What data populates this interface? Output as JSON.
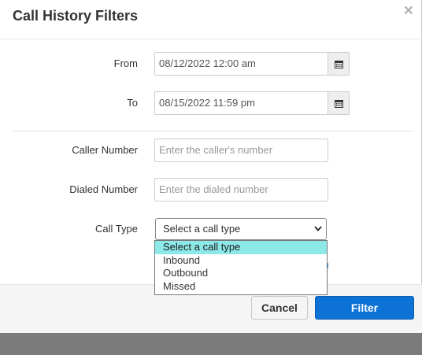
{
  "modal": {
    "title": "Call History Filters",
    "close_symbol": "×"
  },
  "form": {
    "from": {
      "label": "From",
      "value": "08/12/2022 12:00 am"
    },
    "to": {
      "label": "To",
      "value": "08/15/2022 11:59 pm"
    },
    "caller_number": {
      "label": "Caller Number",
      "placeholder": "Enter the caller's number"
    },
    "dialed_number": {
      "label": "Dialed Number",
      "placeholder": "Enter the dialed number"
    },
    "call_type": {
      "label": "Call Type",
      "selected": "Select a call type",
      "options": [
        "Select a call type",
        "Inbound",
        "Outbound",
        "Missed"
      ],
      "highlighted_index": 0,
      "dropdown_open": true
    }
  },
  "footer": {
    "cancel_label": "Cancel",
    "filter_label": "Filter"
  },
  "icons": {
    "calendar": "calendar-icon",
    "close": "close-icon",
    "caret": "chevron-down-icon"
  },
  "colors": {
    "primary": "#0c72d6",
    "highlight": "#8de8e8",
    "overlay": "#7b7b7b"
  }
}
